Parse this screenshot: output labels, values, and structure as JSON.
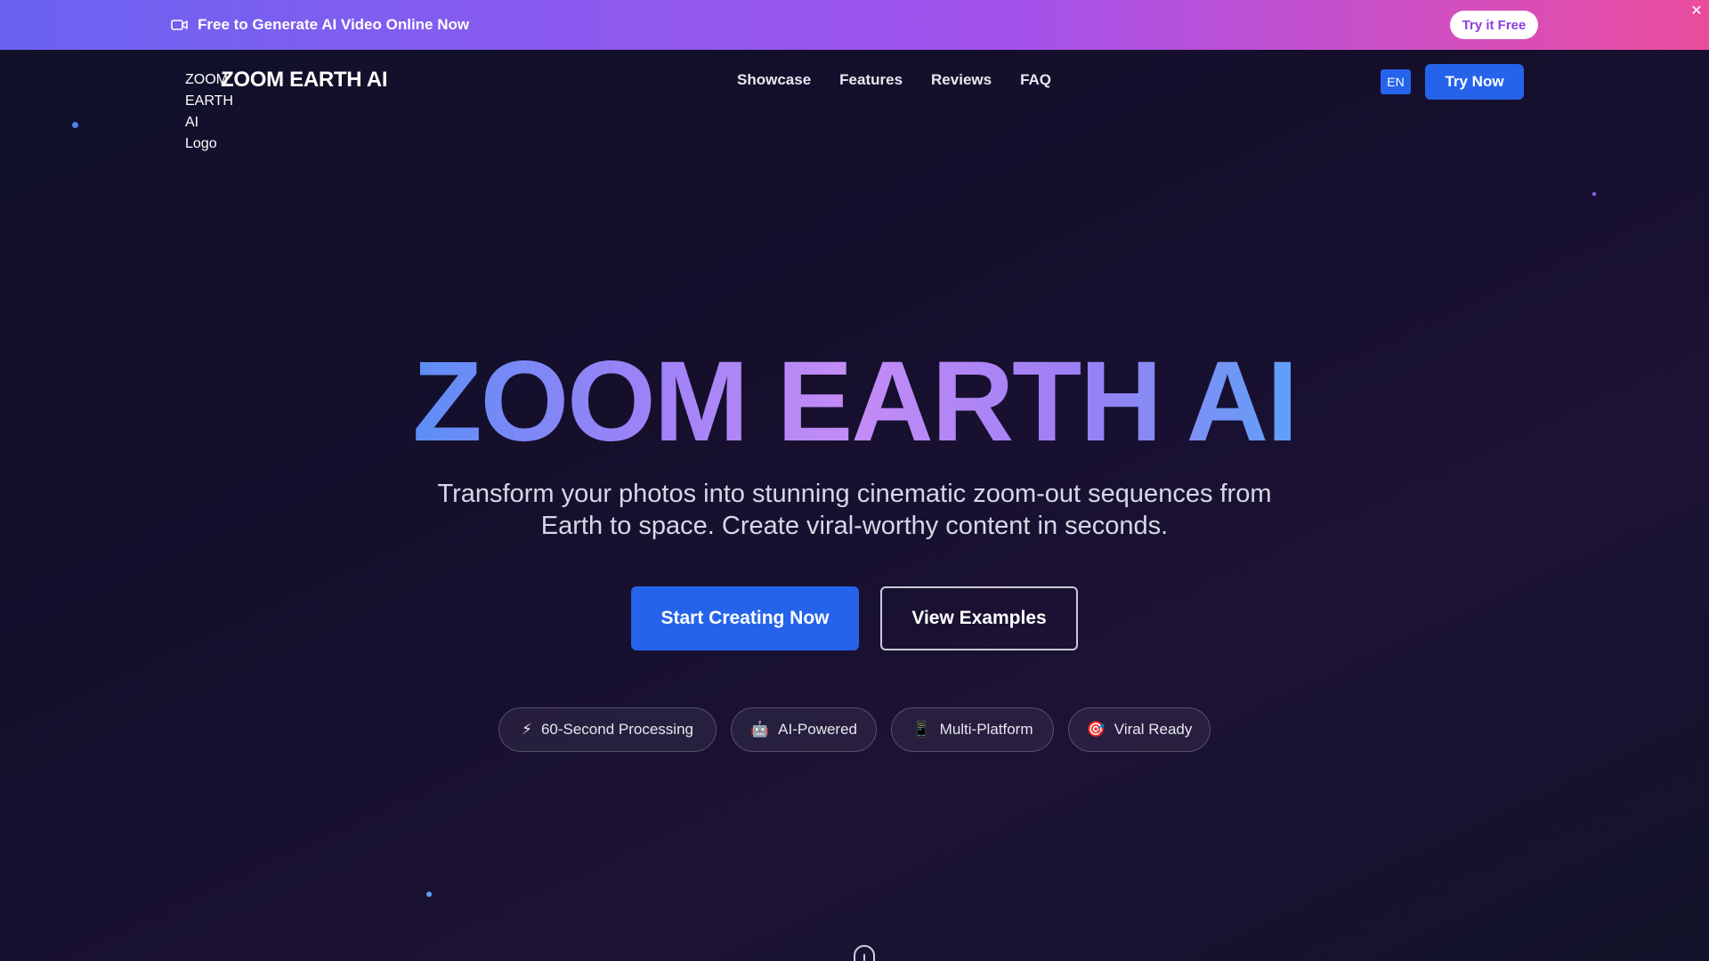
{
  "promo": {
    "icon": "video-camera-icon",
    "text": "Free to Generate AI Video Online Now",
    "button": "Try it Free",
    "close": "✕"
  },
  "nav": {
    "logo_alt": "ZOOM EARTH AI Logo",
    "brand": "ZOOM EARTH AI",
    "links": [
      "Showcase",
      "Features",
      "Reviews",
      "FAQ"
    ],
    "lang": "EN",
    "cta": "Try Now"
  },
  "hero": {
    "title": "ZOOM EARTH AI",
    "subtitle": "Transform your photos into stunning cinematic zoom-out sequences from Earth to space. Create viral-worthy content in seconds.",
    "primary_button": "Start Creating Now",
    "secondary_button": "View Examples"
  },
  "pills": [
    {
      "icon": "⚡",
      "label": "60-Second Processing"
    },
    {
      "icon": "🤖",
      "label": "AI-Powered"
    },
    {
      "icon": "📱",
      "label": "Multi-Platform"
    },
    {
      "icon": "🎯",
      "label": "Viral Ready"
    }
  ],
  "colors": {
    "accent": "#2563eb",
    "banner_start": "#6a63f0",
    "banner_end": "#ea4c9b",
    "background": "#150f2c"
  }
}
